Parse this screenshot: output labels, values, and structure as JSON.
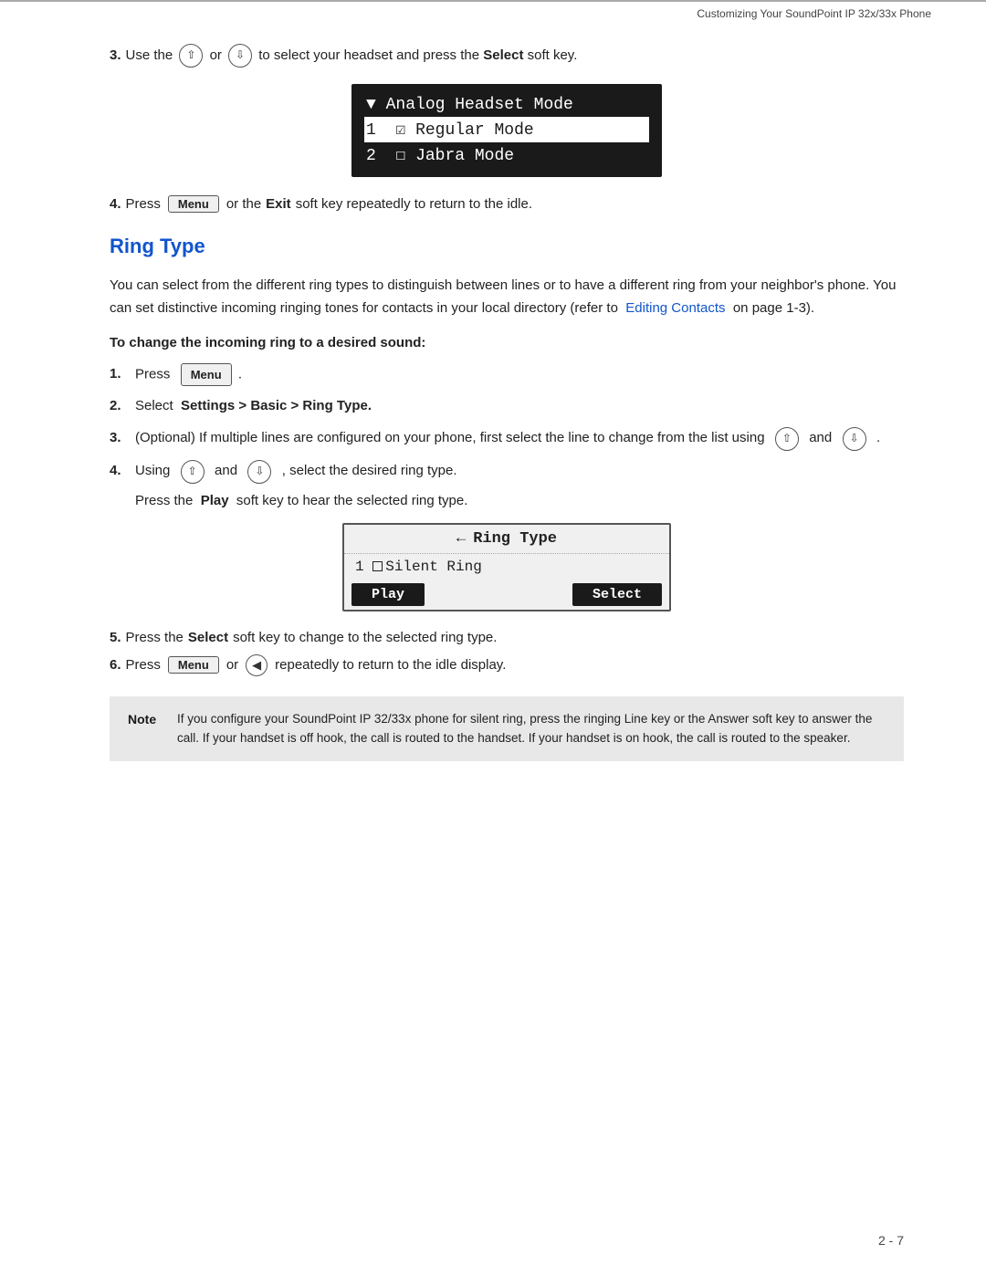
{
  "header": {
    "title": "Customizing Your SoundPoint IP 32x/33x Phone"
  },
  "step3_top": {
    "number": "3.",
    "text_before": "Use the",
    "text_middle": "or",
    "text_after": "to select your headset and press the",
    "bold_word": "Select",
    "text_end": "soft key."
  },
  "headset_screen": {
    "title": "Analog Headset Mode",
    "items": [
      {
        "number": "1",
        "icon": "check",
        "label": "Regular Mode",
        "highlighted": true
      },
      {
        "number": "2",
        "icon": "square",
        "label": "Jabra Mode",
        "highlighted": false
      }
    ]
  },
  "step4_top": {
    "number": "4.",
    "text_before": "Press",
    "menu_label": "Menu",
    "text_after": "or the",
    "bold_word": "Exit",
    "text_end": "soft key repeatedly to return to the idle."
  },
  "ring_type_section": {
    "heading": "Ring Type",
    "body_text": "You can select from the different ring types to distinguish between lines or to have a different ring from your neighbor's phone. You can set distinctive incoming ringing tones for contacts in your local directory (refer to",
    "link_text": "Editing Contacts",
    "body_text2": "on page 1-3).",
    "subheading": "To change the incoming ring to a desired sound:",
    "steps": [
      {
        "num": "1.",
        "text": "Press",
        "menu_label": "Menu",
        "text_after": "."
      },
      {
        "num": "2.",
        "text": "Select",
        "bold": "Settings > Basic > Ring Type.",
        "text_after": ""
      },
      {
        "num": "3.",
        "text": "(Optional) If multiple lines are configured on your phone, first select the line to change from the list using",
        "text_after": "and",
        "text_end": "."
      },
      {
        "num": "4.",
        "text": "Using",
        "text_after": "and",
        "text_end": ", select the desired ring type."
      }
    ],
    "play_press_text": "Press the",
    "play_bold": "Play",
    "play_text_after": "soft key to hear the selected ring type.",
    "ring_screen": {
      "title": "Ring Type",
      "title_icon": "←",
      "items": [
        {
          "number": "1",
          "icon": "square",
          "label": "Silent Ring"
        }
      ],
      "softkeys": [
        "Play",
        "Select"
      ]
    },
    "step5": {
      "num": "5.",
      "text": "Press the",
      "bold": "Select",
      "text_after": "soft key to change to the selected ring type."
    },
    "step6": {
      "num": "6.",
      "text": "Press",
      "menu_label": "Menu",
      "text_middle": "or",
      "text_after": "repeatedly to return to the idle display."
    },
    "note": {
      "label": "Note",
      "text": "If you configure your SoundPoint IP 32/33x phone for silent ring, press the ringing Line key or the Answer soft key to answer the call. If your handset is off hook, the call is routed to the handset. If your handset is on hook, the call is routed to the speaker."
    }
  },
  "footer": {
    "text": "2 - 7"
  }
}
